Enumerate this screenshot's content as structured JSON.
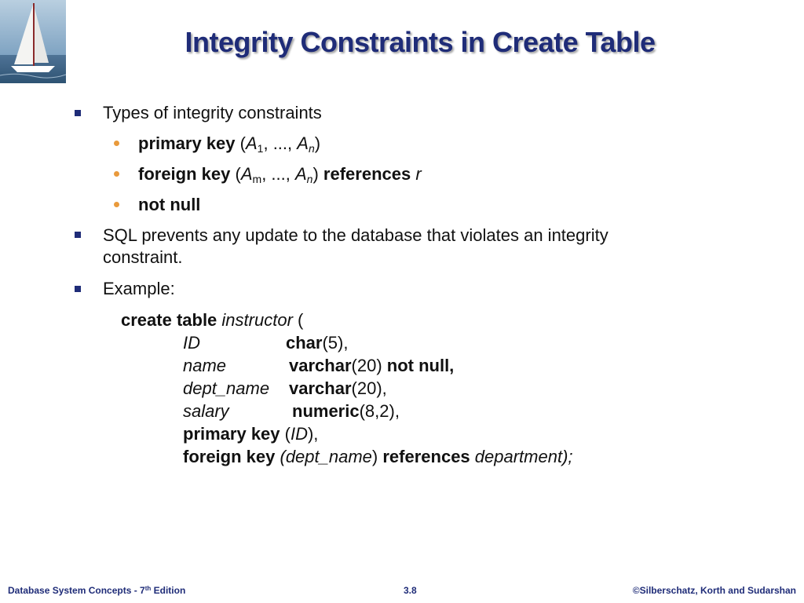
{
  "title": "Integrity Constraints in Create Table",
  "bullets": {
    "b1": "Types of integrity constraints",
    "s1": {
      "kw": "primary key",
      "open": "(",
      "a": "A",
      "sub1": "1",
      "mid": ", ..., ",
      "a2": "A",
      "sub2": "n",
      "close": ")"
    },
    "s2": {
      "kw": "foreign key",
      "open": "(",
      "a": "A",
      "sub1": "m",
      "mid": ", ..., ",
      "a2": "A",
      "sub2": "n",
      "close": ")",
      "kw2": "references",
      "rel": "r"
    },
    "s3": {
      "kw": "not null"
    },
    "b2_line1": "SQL prevents any update to the database that violates an integrity",
    "b2_line2": "constraint.",
    "b3": "Example:"
  },
  "code": {
    "l0": {
      "kw": "create table",
      "name": "instructor",
      "rest": " ("
    },
    "l1": {
      "attr": "ID",
      "type": "char",
      "args": "(5),"
    },
    "l2": {
      "attr": "name",
      "type": "varchar",
      "args": "(20) ",
      "extra": "not null,"
    },
    "l3": {
      "attr": "dept_name",
      "type": "varchar",
      "args": "(20),"
    },
    "l4": {
      "attr": "salary",
      "type": "numeric",
      "args": "(8,2),"
    },
    "l5": {
      "kw": "primary key",
      "open": " (",
      "attr": "ID",
      "close": "),"
    },
    "l6": {
      "kw": "foreign key",
      "attr": " (dept_name",
      "close": ") ",
      "kw2": "references",
      "rel": " department);"
    }
  },
  "footer": {
    "left_main": "Database System Concepts - 7",
    "left_sup": "th",
    "left_end": " Edition",
    "center": "3.8",
    "right": "©Silberschatz, Korth and Sudarshan"
  },
  "colors": {
    "title": "#1f2c78",
    "square_bullet": "#1f2c78",
    "round_bullet": "#e99a3c"
  }
}
